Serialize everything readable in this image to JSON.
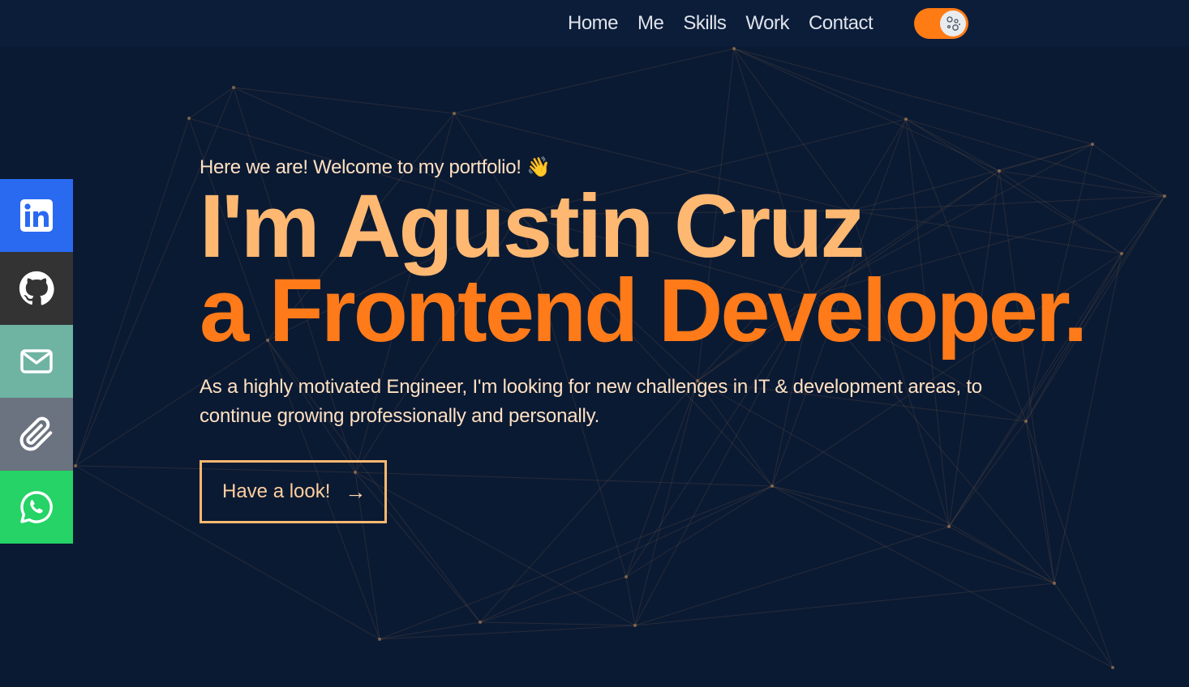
{
  "nav": {
    "items": [
      {
        "label": "Home"
      },
      {
        "label": "Me"
      },
      {
        "label": "Skills"
      },
      {
        "label": "Work"
      },
      {
        "label": "Contact"
      }
    ],
    "theme_toggle_icon": "moon-icon",
    "accent": "#ff7b14"
  },
  "social": [
    {
      "name": "linkedin",
      "icon": "linkedin-icon",
      "color": "#2a6af0"
    },
    {
      "name": "github",
      "icon": "github-icon",
      "color": "#333333"
    },
    {
      "name": "email",
      "icon": "mail-icon",
      "color": "#6fb3a2"
    },
    {
      "name": "resume",
      "icon": "paperclip-icon",
      "color": "#6b7280"
    },
    {
      "name": "whatsapp",
      "icon": "whatsapp-icon",
      "color": "#25d366"
    }
  ],
  "hero": {
    "greeting": "Here we are! Welcome to my portfolio! 👋",
    "name_line": "I'm Agustin Cruz",
    "role_line": "a Frontend Developer.",
    "intro": "As a highly motivated Engineer, I'm looking for new challenges in IT & development areas, to continue growing professionally and personally.",
    "cta_label": "Have a look!",
    "cta_arrow": "→"
  },
  "colors": {
    "background": "#0b1a33",
    "name": "#ffb871",
    "role": "#ff7a18",
    "text": "#ffe1c2"
  }
}
